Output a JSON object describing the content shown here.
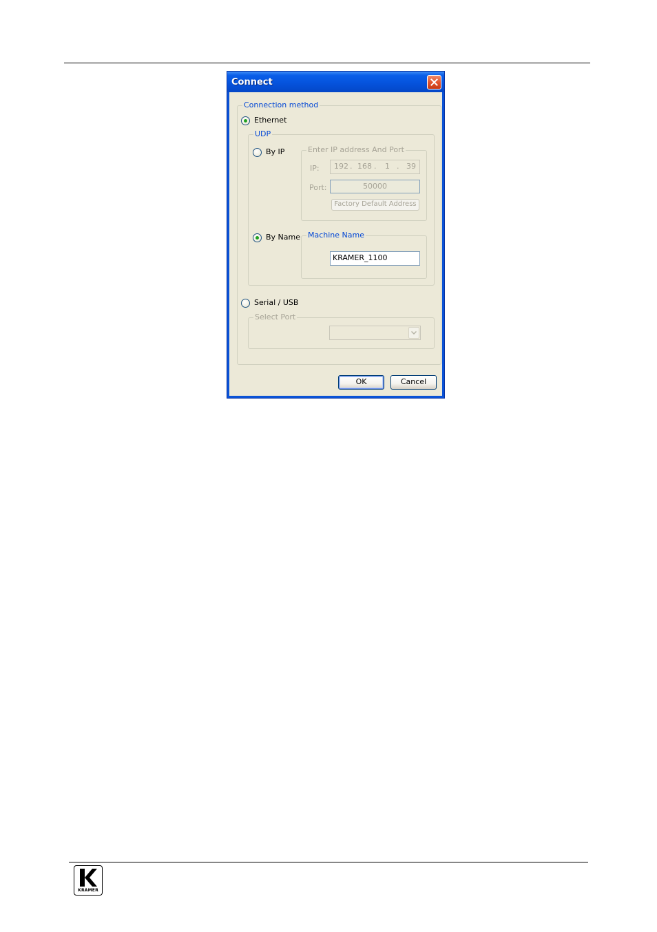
{
  "dialog": {
    "title": "Connect",
    "connection_method": {
      "legend": "Connection method",
      "ethernet": {
        "label": "Ethernet",
        "checked": true
      },
      "udp": {
        "legend": "UDP",
        "by_ip": {
          "label": "By IP",
          "checked": false,
          "group_legend": "Enter IP address And Port",
          "ip_label": "IP:",
          "ip_octets": [
            "192",
            "168",
            "1",
            "39"
          ],
          "port_label": "Port:",
          "port_value": "50000",
          "factory_default_button": "Factory Default Address"
        },
        "by_name": {
          "label": "By Name",
          "checked": true,
          "group_legend": "Machine Name",
          "machine_name_value": "KRAMER_1100"
        }
      },
      "serial": {
        "label": "Serial / USB",
        "checked": false,
        "select_port_legend": "Select Port",
        "selected_port": ""
      }
    },
    "ok_label": "OK",
    "cancel_label": "Cancel"
  },
  "footer": {
    "logo_text": "KRAMER"
  },
  "colors": {
    "titlebar": "#0553dd",
    "dialog_face": "#ece9d8",
    "group_legend_blue": "#0046d5",
    "radio_dot": "#21a121",
    "close_button": "#e2542d"
  }
}
